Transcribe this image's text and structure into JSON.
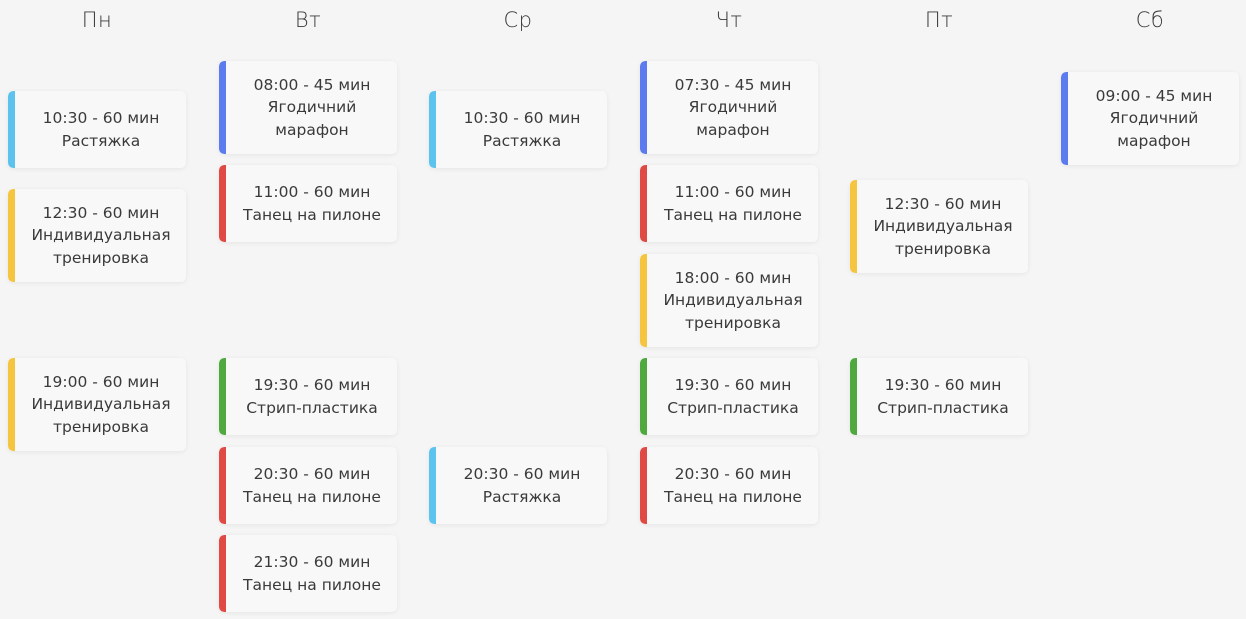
{
  "colors": {
    "background": "#f5f5f5",
    "marathon": "#5b7bef",
    "pole_dance": "#df4b44",
    "stretching": "#5cc3ee",
    "individual": "#f6c53f",
    "strip_plastic": "#4fa93f"
  },
  "days": [
    {
      "label": "Пн",
      "sessions": [
        {
          "time": "10:30 - 60 мин",
          "name": [
            "Растяжка"
          ],
          "color": "#5cc3ee"
        },
        {
          "time": "12:30 - 60 мин",
          "name": [
            "Индивидуальная",
            "тренировка"
          ],
          "color": "#f6c53f"
        },
        {
          "time": "19:00 - 60 мин",
          "name": [
            "Индивидуальная",
            "тренировка"
          ],
          "color": "#f6c53f"
        }
      ]
    },
    {
      "label": "Вт",
      "sessions": [
        {
          "time": "08:00 - 45 мин",
          "name": [
            "Ягодичний",
            "марафон"
          ],
          "color": "#5b7bef"
        },
        {
          "time": "11:00 - 60 мин",
          "name": [
            "Танец на пилоне"
          ],
          "color": "#df4b44"
        },
        {
          "time": "19:30 - 60 мин",
          "name": [
            "Стрип-пластика"
          ],
          "color": "#4fa93f"
        },
        {
          "time": "20:30 - 60 мин",
          "name": [
            "Танец на пилоне"
          ],
          "color": "#df4b44"
        },
        {
          "time": "21:30 - 60 мин",
          "name": [
            "Танец на пилоне"
          ],
          "color": "#df4b44"
        }
      ]
    },
    {
      "label": "Ср",
      "sessions": [
        {
          "time": "10:30 - 60 мин",
          "name": [
            "Растяжка"
          ],
          "color": "#5cc3ee"
        },
        {
          "time": "20:30 - 60 мин",
          "name": [
            "Растяжка"
          ],
          "color": "#5cc3ee"
        }
      ]
    },
    {
      "label": "Чт",
      "sessions": [
        {
          "time": "07:30 - 45 мин",
          "name": [
            "Ягодичний",
            "марафон"
          ],
          "color": "#5b7bef"
        },
        {
          "time": "11:00 - 60 мин",
          "name": [
            "Танец на пилоне"
          ],
          "color": "#df4b44"
        },
        {
          "time": "18:00 - 60 мин",
          "name": [
            "Индивидуальная",
            "тренировка"
          ],
          "color": "#f6c53f"
        },
        {
          "time": "19:30 - 60 мин",
          "name": [
            "Стрип-пластика"
          ],
          "color": "#4fa93f"
        },
        {
          "time": "20:30 - 60 мин",
          "name": [
            "Танец на пилоне"
          ],
          "color": "#df4b44"
        }
      ]
    },
    {
      "label": "Пт",
      "sessions": [
        {
          "time": "12:30 - 60 мин",
          "name": [
            "Индивидуальная",
            "тренировка"
          ],
          "color": "#f6c53f"
        },
        {
          "time": "19:30 - 60 мин",
          "name": [
            "Стрип-пластика"
          ],
          "color": "#4fa93f"
        }
      ]
    },
    {
      "label": "Сб",
      "sessions": [
        {
          "time": "09:00 - 45 мин",
          "name": [
            "Ягодичний",
            "марафон"
          ],
          "color": "#5b7bef"
        }
      ]
    }
  ]
}
